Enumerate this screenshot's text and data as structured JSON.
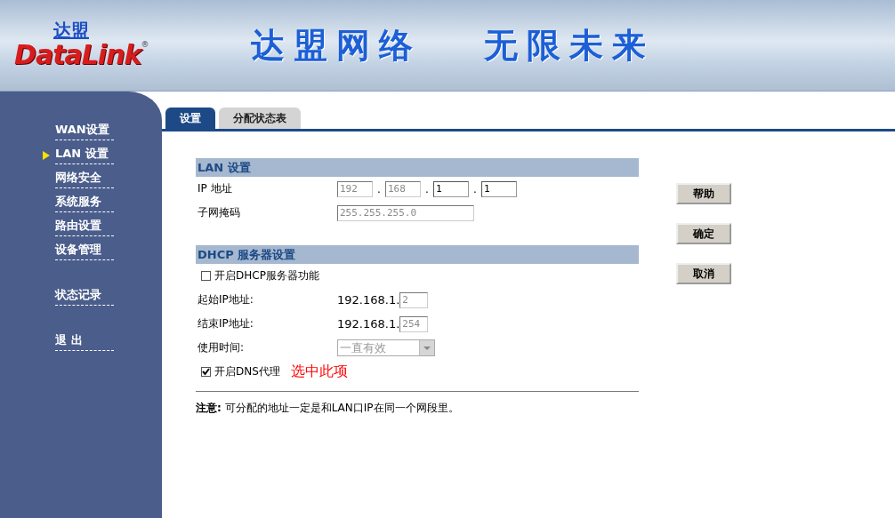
{
  "header": {
    "logo_cn": "达盟",
    "logo_en": "DataLink",
    "registered_mark": "®",
    "slogans": [
      "达盟网络",
      "无限未来"
    ]
  },
  "sidebar": {
    "groups": [
      {
        "items": [
          {
            "label": "WAN设置",
            "selected": false
          },
          {
            "label": "LAN 设置",
            "selected": true
          },
          {
            "label": "网络安全",
            "selected": false
          },
          {
            "label": "系统服务",
            "selected": false
          },
          {
            "label": "路由设置",
            "selected": false
          },
          {
            "label": "设备管理",
            "selected": false
          }
        ]
      },
      {
        "items": [
          {
            "label": "状态记录",
            "selected": false
          }
        ]
      },
      {
        "items": [
          {
            "label": "退 出",
            "selected": false
          }
        ]
      }
    ]
  },
  "tabs": [
    {
      "label": "设置",
      "selected": true
    },
    {
      "label": "分配状态表",
      "selected": false
    }
  ],
  "lan": {
    "title": "LAN 设置",
    "ip_label": "IP 地址",
    "ip_octets": [
      {
        "value": "192",
        "disabled": true
      },
      {
        "value": "168",
        "disabled": true
      },
      {
        "value": "1",
        "disabled": false
      },
      {
        "value": "1",
        "disabled": false
      }
    ],
    "ip_separators": [
      ".",
      ".",
      "."
    ],
    "mask_label": "子网掩码",
    "mask": {
      "value": "255.255.255.0",
      "disabled": true
    }
  },
  "dhcp": {
    "title": "DHCP 服务器设置",
    "enable": {
      "label": "开启DHCP服务器功能",
      "checked": false
    },
    "start": {
      "label": "起始IP地址:",
      "prefix": "192.168.1.",
      "value": "2",
      "disabled": true
    },
    "end": {
      "label": "结束IP地址:",
      "prefix": "192.168.1.",
      "value": "254",
      "disabled": true
    },
    "lease": {
      "label": "使用时间:",
      "value": "一直有效",
      "disabled": true
    },
    "dns": {
      "label": "开启DNS代理",
      "checked": true
    },
    "annotation": "选中此项",
    "note": "**注意:** 可分配的地址一定是和LAN口IP在同一个网段里。"
  },
  "buttons": [
    "帮助",
    "确定",
    "取消"
  ]
}
